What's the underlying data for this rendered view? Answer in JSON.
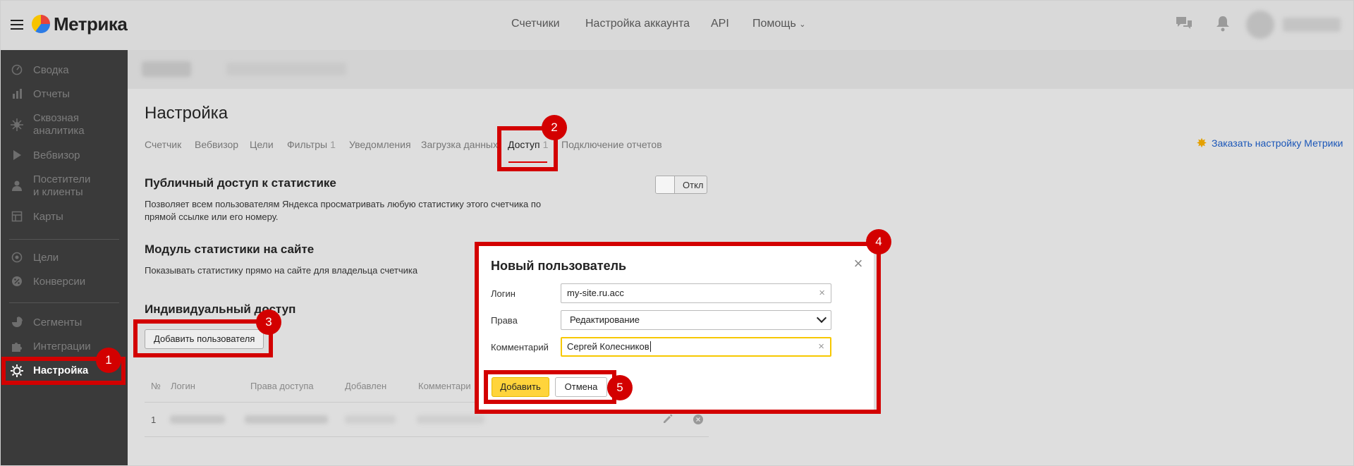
{
  "header": {
    "logo_text": "Метрика",
    "nav": [
      "Счетчики",
      "Настройка аккаунта",
      "API",
      "Помощь"
    ]
  },
  "sidebar": {
    "items": [
      {
        "label": "Сводка",
        "icon": "dashboard-icon"
      },
      {
        "label": "Отчеты",
        "icon": "bar-chart-icon"
      },
      {
        "label": "Сквозная аналитика",
        "icon": "crosshair-icon"
      },
      {
        "label": "Вебвизор",
        "icon": "play-icon"
      },
      {
        "label": "Посетители и клиенты",
        "icon": "user-icon"
      },
      {
        "label": "Карты",
        "icon": "map-icon"
      },
      {
        "label": "Цели",
        "icon": "target-icon"
      },
      {
        "label": "Конверсии",
        "icon": "percent-icon"
      },
      {
        "label": "Сегменты",
        "icon": "pie-icon"
      },
      {
        "label": "Интеграции",
        "icon": "puzzle-icon"
      },
      {
        "label": "Настройка",
        "icon": "gear-icon"
      }
    ],
    "line1": {
      "item2": "Сквозная",
      "item2b": "аналитика",
      "item4": "Посетители",
      "item4b": "и клиенты"
    }
  },
  "page": {
    "title": "Настройка",
    "tabs": [
      {
        "label": "Счетчик"
      },
      {
        "label": "Вебвизор"
      },
      {
        "label": "Цели"
      },
      {
        "label": "Фильтры",
        "count": "1"
      },
      {
        "label": "Уведомления"
      },
      {
        "label": "Загрузка данных"
      },
      {
        "label": "Доступ",
        "count": "1"
      },
      {
        "label": "Подключение отчетов"
      }
    ],
    "order_link": "Заказать настройку Метрики",
    "public_access": {
      "title": "Публичный доступ к статистике",
      "desc_line1": "Позволяет всем пользователям Яндекса просматривать любую статистику этого счетчика по",
      "desc_line2": "прямой ссылке или его номеру.",
      "toggle_label": "Откл"
    },
    "module": {
      "title": "Модуль статистики на сайте",
      "desc": "Показывать статистику прямо на сайте для владельца счетчика"
    },
    "individual": {
      "title": "Индивидуальный доступ",
      "add_button": "Добавить пользователя",
      "columns": [
        "№",
        "Логин",
        "Права доступа",
        "Добавлен",
        "Комментари"
      ],
      "rows": [
        {
          "num": "1"
        }
      ]
    }
  },
  "dialog": {
    "title": "Новый пользователь",
    "login_label": "Логин",
    "login_value": "my-site.ru.acc",
    "rights_label": "Права",
    "rights_value": "Редактирование",
    "comment_label": "Комментарий",
    "comment_value": "Сергей Колесников",
    "add_button": "Добавить",
    "cancel_button": "Отмена"
  },
  "annotations": [
    "1",
    "2",
    "3",
    "4",
    "5"
  ],
  "colors": {
    "highlight_red": "#d30000",
    "primary_yellow": "#ffd43b",
    "link_blue": "#1a56b8"
  }
}
